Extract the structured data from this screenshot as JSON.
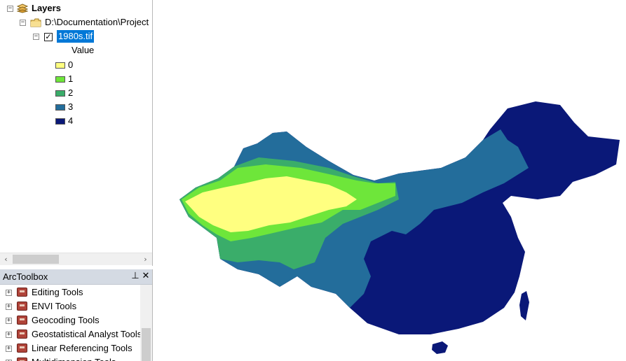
{
  "toc": {
    "root_label": "Layers",
    "folder_label": "D:\\Documentation\\Project",
    "layer_label": "1980s.tif",
    "layer_checked": true,
    "legend_heading": "Value",
    "legend": [
      {
        "label": "0",
        "color": "#ffff80"
      },
      {
        "label": "1",
        "color": "#6ee63a"
      },
      {
        "label": "2",
        "color": "#3aad6a"
      },
      {
        "label": "3",
        "color": "#236d9b"
      },
      {
        "label": "4",
        "color": "#0a1878"
      }
    ]
  },
  "arctoolbox": {
    "title": "ArcToolbox",
    "pin_icon": "pin-icon",
    "close_icon": "close-icon",
    "items": [
      {
        "label": "Editing Tools"
      },
      {
        "label": "ENVI Tools"
      },
      {
        "label": "Geocoding Tools"
      },
      {
        "label": "Geostatistical Analyst Tools"
      },
      {
        "label": "Linear Referencing Tools"
      },
      {
        "label": "Multidimension Tools"
      }
    ]
  },
  "map": {
    "colors": {
      "0": "#ffff80",
      "1": "#6ee63a",
      "2": "#3aad6a",
      "3": "#236d9b",
      "4": "#0a1878"
    }
  }
}
